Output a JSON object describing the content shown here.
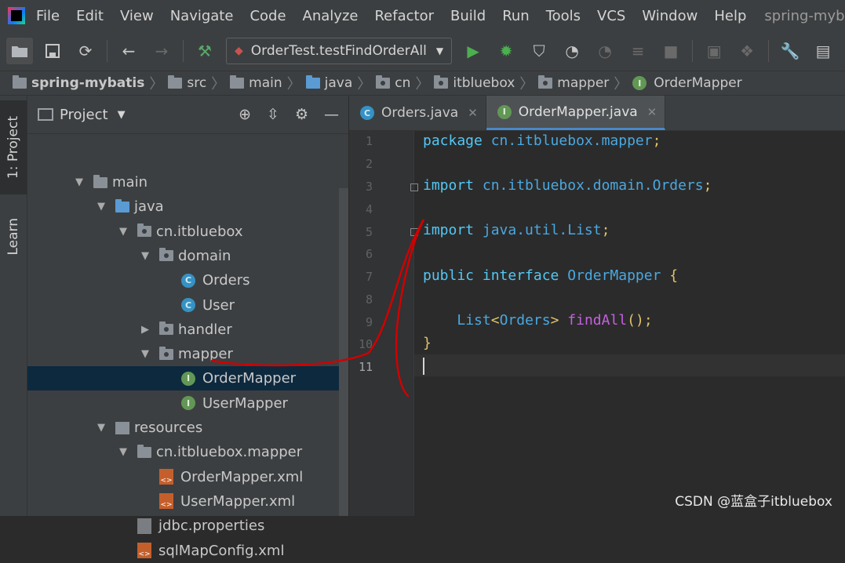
{
  "menubar": {
    "items": [
      "File",
      "Edit",
      "View",
      "Navigate",
      "Code",
      "Analyze",
      "Refactor",
      "Build",
      "Run",
      "Tools",
      "VCS",
      "Window",
      "Help"
    ],
    "window_title": "spring-mybatis [D:\\"
  },
  "toolbar": {
    "run_config": "OrderTest.testFindOrderAll",
    "icons": [
      "open-folder-icon",
      "save-icon",
      "sync-icon",
      "back-arrow-icon",
      "forward-arrow-icon",
      "hammer-icon",
      "run-icon",
      "debug-icon",
      "coverage-icon",
      "profile-icon",
      "attach-icon",
      "step-icon",
      "stop-icon",
      "device-icon",
      "deploy-icon",
      "wrench-icon",
      "structure-icon"
    ]
  },
  "breadcrumb": [
    "spring-mybatis",
    "src",
    "main",
    "java",
    "cn",
    "itbluebox",
    "mapper",
    "OrderMapper"
  ],
  "left_sidebar": {
    "project_tab": "1: Project",
    "learn_tab": "Learn"
  },
  "project_panel": {
    "title": "Project",
    "tree": [
      {
        "label": "main",
        "depth": 0,
        "icon": "folder",
        "arrow": "down"
      },
      {
        "label": "java",
        "depth": 1,
        "icon": "folder-blue",
        "arrow": "down"
      },
      {
        "label": "cn.itbluebox",
        "depth": 2,
        "icon": "package",
        "arrow": "down"
      },
      {
        "label": "domain",
        "depth": 3,
        "icon": "package",
        "arrow": "down"
      },
      {
        "label": "Orders",
        "depth": 4,
        "icon": "class",
        "arrow": "none"
      },
      {
        "label": "User",
        "depth": 4,
        "icon": "class",
        "arrow": "none"
      },
      {
        "label": "handler",
        "depth": 3,
        "icon": "package",
        "arrow": "right"
      },
      {
        "label": "mapper",
        "depth": 3,
        "icon": "package",
        "arrow": "down"
      },
      {
        "label": "OrderMapper",
        "depth": 4,
        "icon": "interface",
        "arrow": "none",
        "selected": true
      },
      {
        "label": "UserMapper",
        "depth": 4,
        "icon": "interface",
        "arrow": "none"
      },
      {
        "label": "resources",
        "depth": 1,
        "icon": "resources",
        "arrow": "down"
      },
      {
        "label": "cn.itbluebox.mapper",
        "depth": 2,
        "icon": "folder",
        "arrow": "down"
      },
      {
        "label": "OrderMapper.xml",
        "depth": 3,
        "icon": "xml",
        "arrow": "none"
      },
      {
        "label": "UserMapper.xml",
        "depth": 3,
        "icon": "xml",
        "arrow": "none"
      },
      {
        "label": "jdbc.properties",
        "depth": 2,
        "icon": "props",
        "arrow": "none"
      },
      {
        "label": "sqlMapConfig.xml",
        "depth": 2,
        "icon": "xml",
        "arrow": "none"
      }
    ]
  },
  "editor": {
    "tabs": [
      {
        "label": "Orders.java",
        "icon": "class"
      },
      {
        "label": "OrderMapper.java",
        "icon": "interface",
        "active": true
      }
    ],
    "line_numbers": [
      "1",
      "2",
      "3",
      "4",
      "5",
      "6",
      "7",
      "8",
      "9",
      "10",
      "11"
    ],
    "code": {
      "l1_kw": "package",
      "l1_rest": " cn.itbluebox.mapper",
      "l1_sc": ";",
      "l3_kw": "import",
      "l3_rest": " cn.itbluebox.domain.Orders",
      "l3_sc": ";",
      "l5_kw": "import",
      "l5_rest": " java.util.List",
      "l5_sc": ";",
      "l7_kw": "public interface",
      "l7_rest": " OrderMapper ",
      "l7_brace": "{",
      "l9_indent": "    ",
      "l9_type": "List",
      "l9_lt": "<",
      "l9_generic": "Orders",
      "l9_gt": ">",
      "l9_meth": " findAll",
      "l9_paren": "();",
      "l10_brace": "}"
    }
  },
  "watermark": "CSDN @蓝盒子itbluebox",
  "colors": {
    "selection": "#0d293e",
    "tab_underline": "#4a88c7",
    "annotation": "#d10000"
  }
}
